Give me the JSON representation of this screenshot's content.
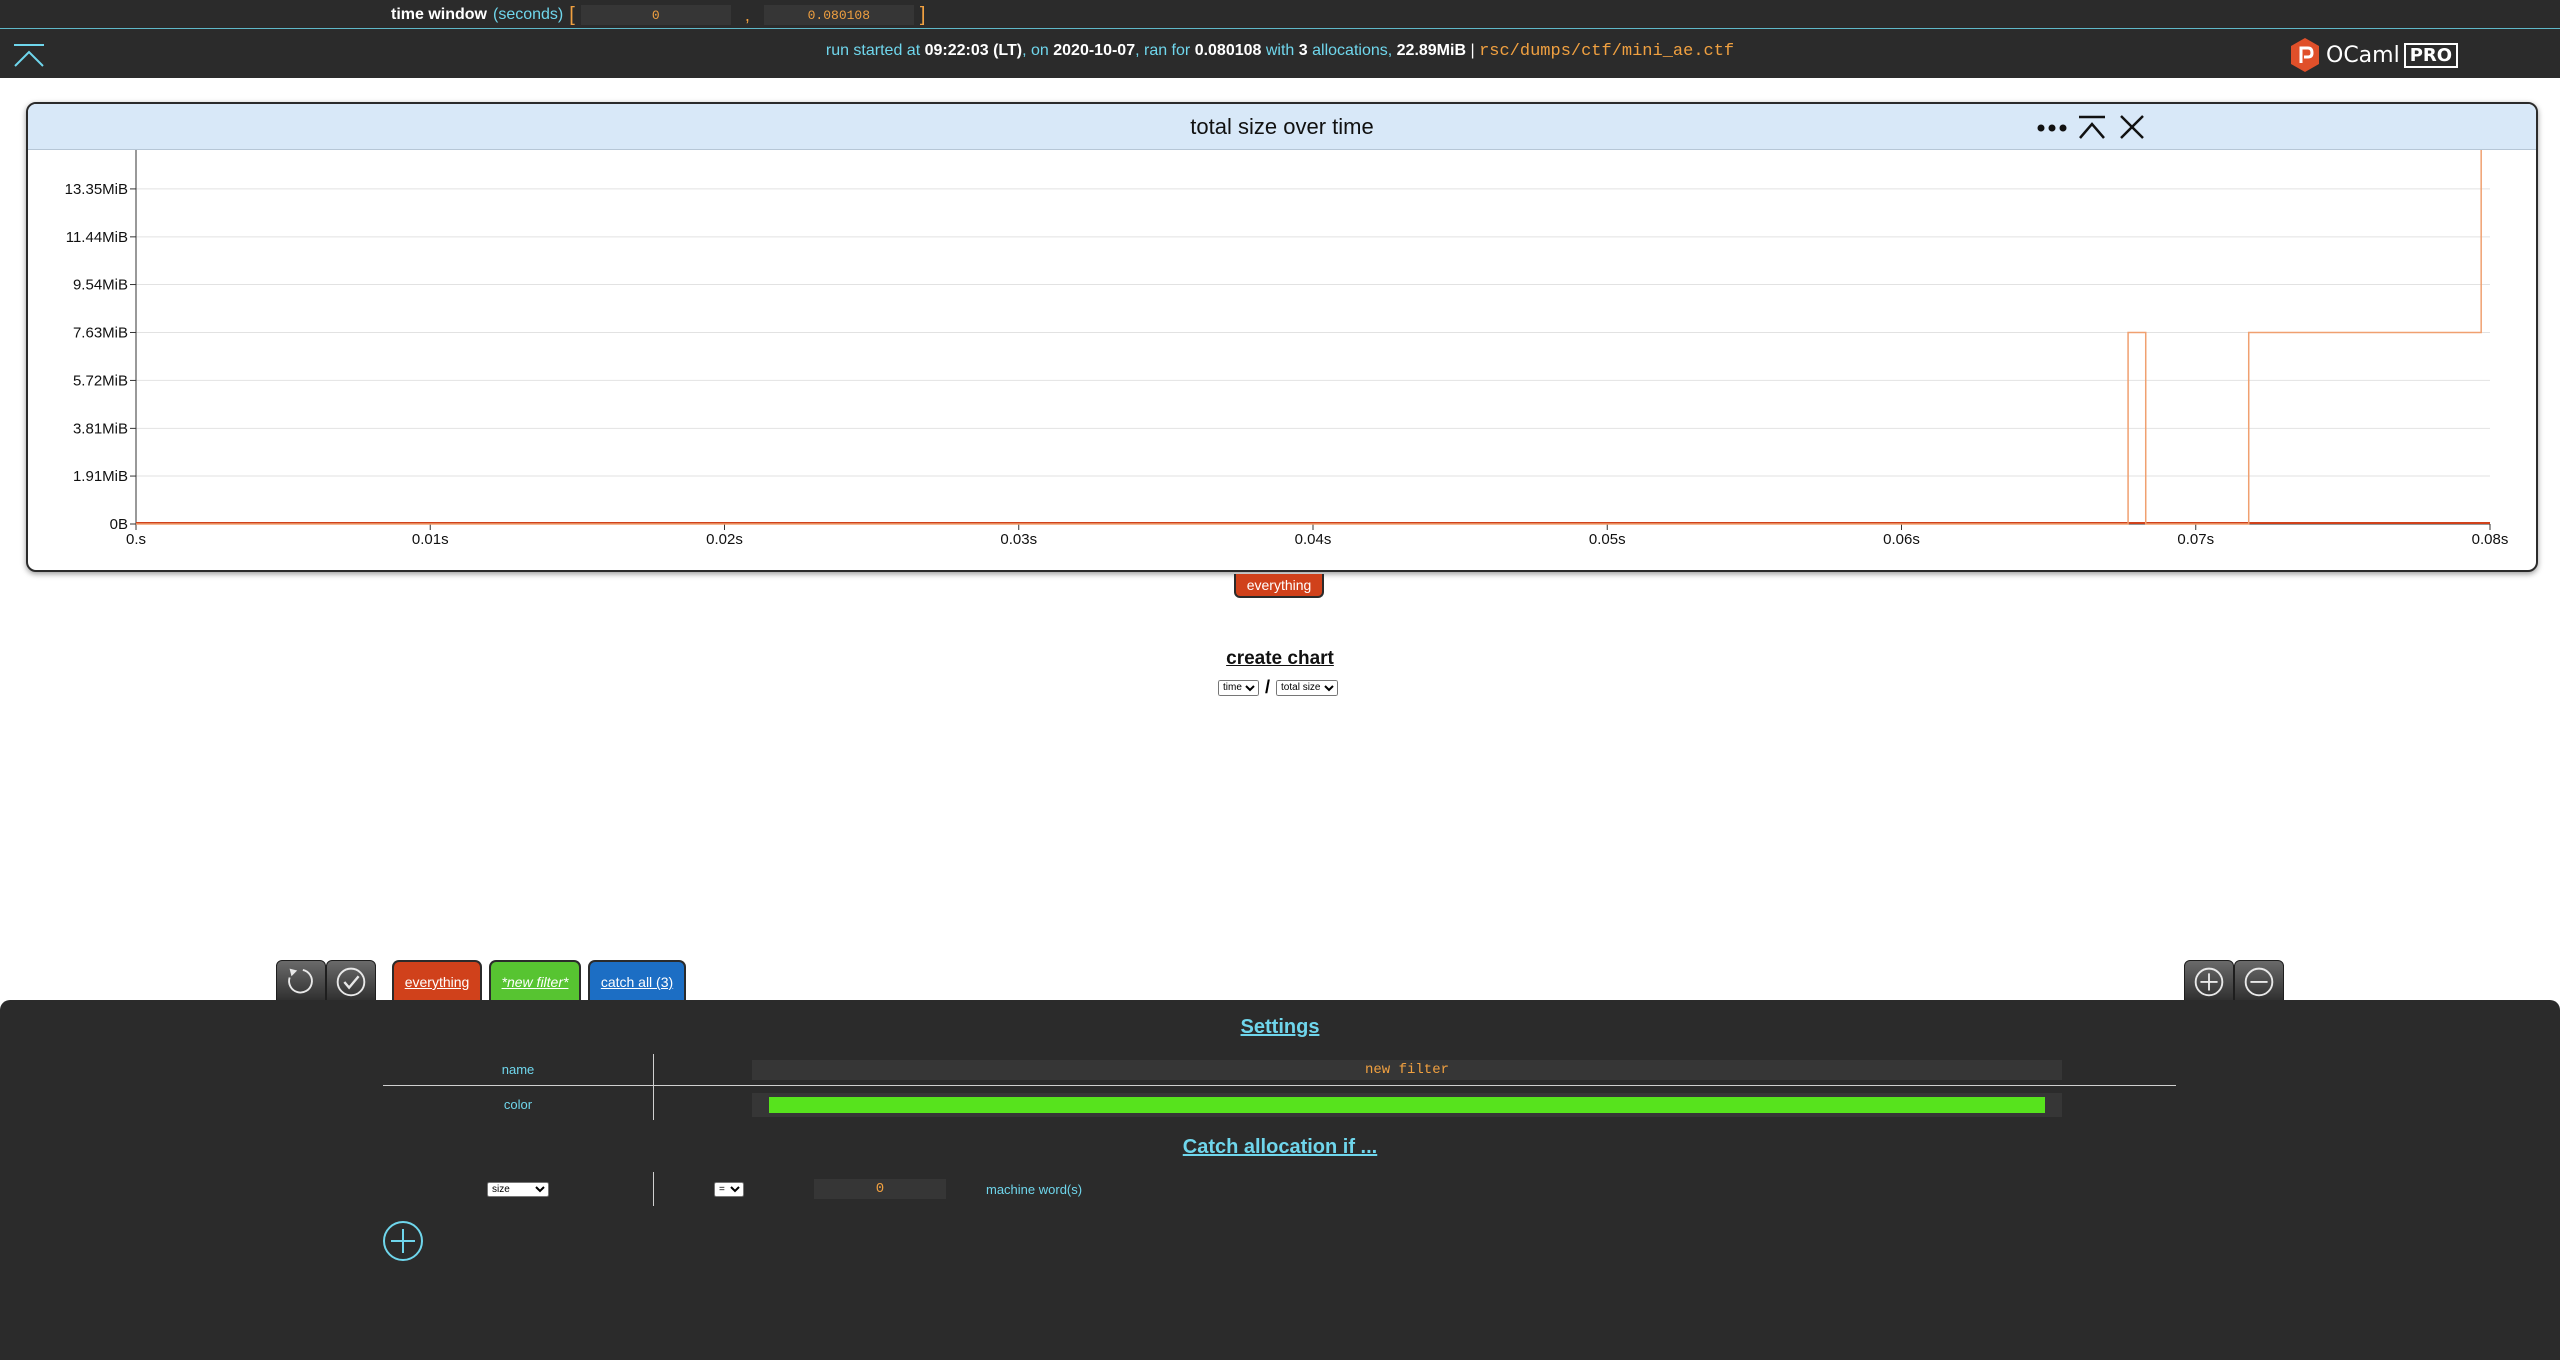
{
  "time_window": {
    "label": "time window",
    "units": "(seconds)",
    "open_bracket": "[",
    "close_bracket": "]",
    "start": "0",
    "end": "0.080108",
    "separator": ","
  },
  "run_info": {
    "prefix": "run started at",
    "start_time": "09:22:03 (LT)",
    "on": ", on",
    "date": "2020-10-07",
    "ran_for": ", ran for",
    "duration": "0.080108",
    "with": "with",
    "alloc_count": "3",
    "allocations": "allocations,",
    "total_size": "22.89MiB",
    "sep": "|",
    "path": "rsc/dumps/ctf/mini_ae.ctf"
  },
  "logo": {
    "ocaml": "OCaml",
    "pro": "PRO",
    "brand_color": "#e0502a"
  },
  "chart": {
    "title": "total size over time",
    "legend_label": "everything"
  },
  "chart_data": {
    "type": "line",
    "title": "total size over time",
    "xlabel": "",
    "ylabel": "",
    "xlim": [
      0,
      0.08
    ],
    "ylim": [
      0,
      14.9
    ],
    "x_ticks": [
      "0.s",
      "0.01s",
      "0.02s",
      "0.03s",
      "0.04s",
      "0.05s",
      "0.06s",
      "0.07s",
      "0.08s"
    ],
    "x_tick_values": [
      0,
      0.01,
      0.02,
      0.03,
      0.04,
      0.05,
      0.06,
      0.07,
      0.08
    ],
    "y_ticks": [
      "0B",
      "1.91MiB",
      "3.81MiB",
      "5.72MiB",
      "7.63MiB",
      "9.54MiB",
      "11.44MiB",
      "13.35MiB"
    ],
    "y_tick_values": [
      0,
      1.91,
      3.81,
      5.72,
      7.63,
      9.54,
      11.44,
      13.35
    ],
    "grid": true,
    "series": [
      {
        "name": "everything",
        "color": "#f0a070",
        "step": true,
        "x": [
          0,
          0.0677,
          0.0677,
          0.0683,
          0.0683,
          0.0718,
          0.0718,
          0.0797,
          0.0797,
          0.08
        ],
        "y": [
          0,
          0,
          7.63,
          7.63,
          0,
          0,
          7.63,
          7.63,
          15.26,
          15.26
        ]
      }
    ]
  },
  "create_chart": {
    "label": "create chart",
    "x_options": [
      "time"
    ],
    "x_selected": "time",
    "slash": "/",
    "y_options": [
      "total size"
    ],
    "y_selected": "total size"
  },
  "tabs": [
    {
      "label": "everything",
      "color": "#d0411b"
    },
    {
      "label": "*new filter*",
      "color": "#57c431"
    },
    {
      "label": "catch all (3)",
      "color": "#1c6ec4"
    }
  ],
  "settings": {
    "title": "Settings",
    "name_label": "name",
    "name_value": "new filter",
    "color_label": "color",
    "color_value": "#57e31d",
    "catch_title": "Catch allocation if ...",
    "condition": {
      "field_options": [
        "size"
      ],
      "field": "size",
      "op_options": [
        "="
      ],
      "op": "=",
      "value": "0",
      "unit": "machine word(s)"
    }
  }
}
